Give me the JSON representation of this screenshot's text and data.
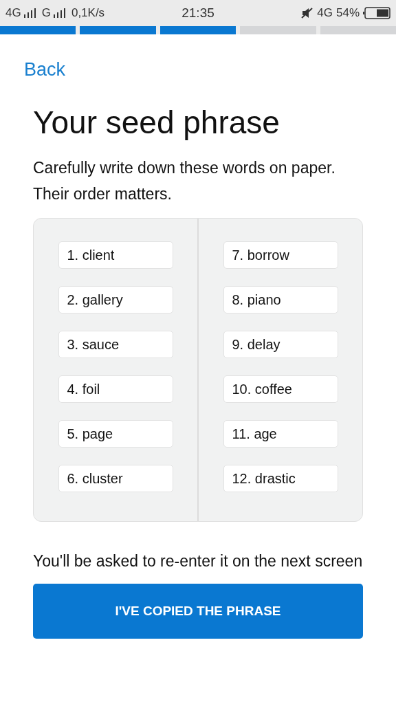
{
  "status_bar": {
    "network_1": "4G",
    "network_2": "G",
    "speed": "0,1K/s",
    "time": "21:35",
    "network_3": "4G",
    "battery": "54%"
  },
  "progress_steps": [
    {
      "done": true
    },
    {
      "done": true
    },
    {
      "done": true
    },
    {
      "done": false
    },
    {
      "done": false
    }
  ],
  "back_link": "Back",
  "title": "Your seed phrase",
  "instructions": "Carefully write down these words on paper. Their order matters.",
  "words": [
    "1. client",
    "2. gallery",
    "3. sauce",
    "4. foil",
    "5. page",
    "6. cluster",
    "7. borrow",
    "8. piano",
    "9. delay",
    "10. coffee",
    "11. age",
    "12. drastic"
  ],
  "note": "You'll be asked to re-enter it on the next screen",
  "button": "I'VE COPIED THE PHRASE"
}
